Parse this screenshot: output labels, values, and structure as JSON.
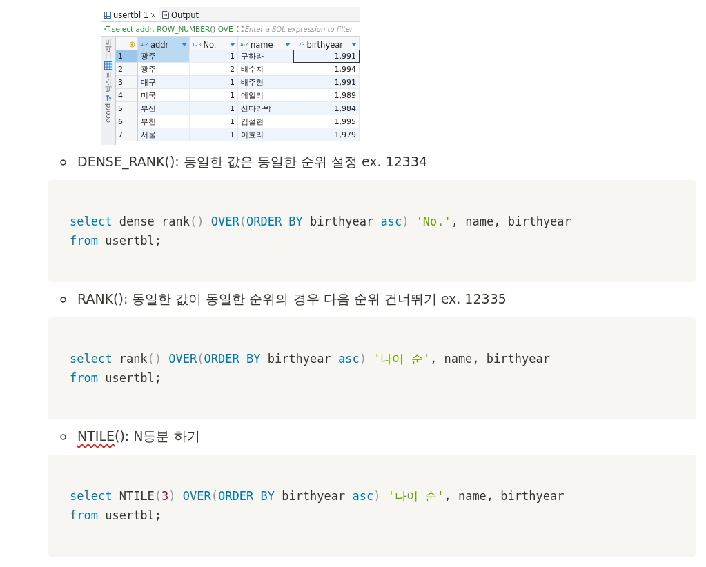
{
  "result_panel": {
    "tabs": [
      {
        "label": "usertbl 1",
        "kind": "table",
        "closable": true,
        "selected": true
      },
      {
        "label": "Output",
        "kind": "output",
        "closable": false,
        "selected": false
      }
    ],
    "filter": {
      "query": "select addr, ROW_NUMBER() OVE",
      "placeholder": "Enter a SQL expression to filter"
    },
    "side_tabs": [
      {
        "label": "그리드",
        "kind": "grid",
        "selected": true
      },
      {
        "label": "텍스트",
        "kind": "text",
        "selected": false
      },
      {
        "label": "ecord",
        "kind": "record",
        "selected": false
      }
    ],
    "columns": [
      {
        "type_label": "A-Z",
        "label": "addr",
        "kind": "text",
        "selected": true
      },
      {
        "type_label": "123",
        "label": "No.",
        "kind": "number",
        "selected": false
      },
      {
        "type_label": "A-Z",
        "label": "name",
        "kind": "text",
        "selected": false
      },
      {
        "type_label": "123",
        "label": "birthyear",
        "kind": "number",
        "selected": false
      }
    ],
    "rows": [
      {
        "number": "1",
        "selected": true,
        "cells": [
          {
            "text": "광주",
            "selected": true,
            "focused": false
          },
          {
            "text": "1",
            "selected": false,
            "focused": false
          },
          {
            "text": "구하라",
            "selected": false,
            "focused": false
          },
          {
            "text": "1,991",
            "selected": false,
            "focused": true
          }
        ]
      },
      {
        "number": "2",
        "selected": false,
        "cells": [
          {
            "text": "광주",
            "selected": false,
            "focused": false
          },
          {
            "text": "2",
            "selected": false,
            "focused": false
          },
          {
            "text": "배수지",
            "selected": false,
            "focused": false
          },
          {
            "text": "1,994",
            "selected": false,
            "focused": false
          }
        ]
      },
      {
        "number": "3",
        "selected": false,
        "cells": [
          {
            "text": "대구",
            "selected": false,
            "focused": false
          },
          {
            "text": "1",
            "selected": false,
            "focused": false
          },
          {
            "text": "배주현",
            "selected": false,
            "focused": false
          },
          {
            "text": "1,991",
            "selected": false,
            "focused": false
          }
        ]
      },
      {
        "number": "4",
        "selected": false,
        "cells": [
          {
            "text": "미국",
            "selected": false,
            "focused": false
          },
          {
            "text": "1",
            "selected": false,
            "focused": false
          },
          {
            "text": "에일리",
            "selected": false,
            "focused": false
          },
          {
            "text": "1,989",
            "selected": false,
            "focused": false
          }
        ]
      },
      {
        "number": "5",
        "selected": false,
        "cells": [
          {
            "text": "부산",
            "selected": false,
            "focused": false
          },
          {
            "text": "1",
            "selected": false,
            "focused": false
          },
          {
            "text": "산다라박",
            "selected": false,
            "focused": false
          },
          {
            "text": "1,984",
            "selected": false,
            "focused": false
          }
        ]
      },
      {
        "number": "6",
        "selected": false,
        "cells": [
          {
            "text": "부천",
            "selected": false,
            "focused": false
          },
          {
            "text": "1",
            "selected": false,
            "focused": false
          },
          {
            "text": "김설현",
            "selected": false,
            "focused": false
          },
          {
            "text": "1,995",
            "selected": false,
            "focused": false
          }
        ]
      },
      {
        "number": "7",
        "selected": false,
        "cells": [
          {
            "text": "서울",
            "selected": false,
            "focused": false
          },
          {
            "text": "1",
            "selected": false,
            "focused": false
          },
          {
            "text": "이효리",
            "selected": false,
            "focused": false
          },
          {
            "text": "1,979",
            "selected": false,
            "focused": false
          }
        ]
      }
    ]
  },
  "sections": [
    {
      "bullet": [
        {
          "text": "DENSE_RANK(): 동일한 값은 동일한 순위 설정 ex. 12334",
          "misspelled": false
        }
      ],
      "code": [
        [
          {
            "kind": "keyword",
            "text": "select"
          },
          {
            "kind": "plain",
            "text": " dense_rank"
          },
          {
            "kind": "punct",
            "text": "() "
          },
          {
            "kind": "keyword",
            "text": "OVER"
          },
          {
            "kind": "punct",
            "text": "("
          },
          {
            "kind": "keyword",
            "text": "ORDER BY"
          },
          {
            "kind": "plain",
            "text": " birthyear "
          },
          {
            "kind": "keyword",
            "text": "asc"
          },
          {
            "kind": "punct",
            "text": ") "
          },
          {
            "kind": "string",
            "text": "'No.'"
          },
          {
            "kind": "plain",
            "text": ", name, birthyear"
          }
        ],
        [
          {
            "kind": "keyword",
            "text": "from"
          },
          {
            "kind": "plain",
            "text": " usertbl;"
          }
        ]
      ]
    },
    {
      "bullet": [
        {
          "text": "RANK(): 동일한 값이 동일한 순위의 경우 다음 순위 건너뛰기 ex. 12335",
          "misspelled": false
        }
      ],
      "code": [
        [
          {
            "kind": "keyword",
            "text": "select"
          },
          {
            "kind": "plain",
            "text": " rank"
          },
          {
            "kind": "punct",
            "text": "() "
          },
          {
            "kind": "keyword",
            "text": "OVER"
          },
          {
            "kind": "punct",
            "text": "("
          },
          {
            "kind": "keyword",
            "text": "ORDER BY"
          },
          {
            "kind": "plain",
            "text": " birthyear "
          },
          {
            "kind": "keyword",
            "text": "asc"
          },
          {
            "kind": "punct",
            "text": ") "
          },
          {
            "kind": "string",
            "text": "'나이 순'"
          },
          {
            "kind": "plain",
            "text": ", name, birthyear"
          }
        ],
        [
          {
            "kind": "keyword",
            "text": "from"
          },
          {
            "kind": "plain",
            "text": " usertbl;"
          }
        ]
      ]
    },
    {
      "bullet": [
        {
          "text": "NTILE",
          "misspelled": true
        },
        {
          "text": "(): N등분 하기",
          "misspelled": false
        }
      ],
      "code": [
        [
          {
            "kind": "keyword",
            "text": "select"
          },
          {
            "kind": "plain",
            "text": " NTILE"
          },
          {
            "kind": "punct",
            "text": "("
          },
          {
            "kind": "number",
            "text": "3"
          },
          {
            "kind": "punct",
            "text": ") "
          },
          {
            "kind": "keyword",
            "text": "OVER"
          },
          {
            "kind": "punct",
            "text": "("
          },
          {
            "kind": "keyword",
            "text": "ORDER BY"
          },
          {
            "kind": "plain",
            "text": " birthyear "
          },
          {
            "kind": "keyword",
            "text": "asc"
          },
          {
            "kind": "punct",
            "text": ") "
          },
          {
            "kind": "string",
            "text": "'나이 순'"
          },
          {
            "kind": "plain",
            "text": ", name, birthyear"
          }
        ],
        [
          {
            "kind": "keyword",
            "text": "from"
          },
          {
            "kind": "plain",
            "text": " usertbl;"
          }
        ]
      ]
    }
  ]
}
